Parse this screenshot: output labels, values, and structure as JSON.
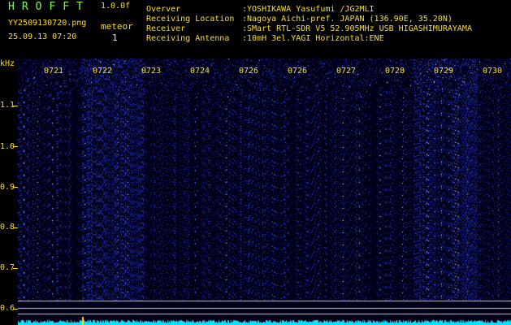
{
  "header": {
    "app_title": "HROFFT",
    "version": "1.0.0f",
    "filename": "YY2509130720.png",
    "mode": "meteor",
    "datetime": "25.09.13 07:20",
    "meteor_count": "1",
    "info": [
      {
        "label": "Overver",
        "value": ":YOSHIKAWA Yasufumi /JG2MLI"
      },
      {
        "label": "Receiving Location",
        "value": ":Nagoya Aichi-pref. JAPAN (136.90E, 35.20N)"
      },
      {
        "label": "Receiver",
        "value": ":SMart RTL-SDR V5 52.905MHz USB HIGASHIMURAYAMA"
      },
      {
        "label": "Receiving Antenna",
        "value": ":10mH 3el.YAGI Horizontal:ENE"
      }
    ]
  },
  "axis": {
    "y_unit": "kHz",
    "y_ticks": [
      "1.1",
      "1.0",
      "0.9",
      "0.8",
      "0.7",
      "0.6"
    ],
    "x_ticks": [
      "0721",
      "0722",
      "0723",
      "0724",
      "0726",
      "0726",
      "0727",
      "0728",
      "0729",
      "0730"
    ]
  },
  "colors": {
    "background": "#000000",
    "label_yellow": "#ffe000",
    "title_green": "#7cff3a",
    "waterfall_blue": "#2233cc",
    "baseline_cyan": "#00e5ff"
  }
}
